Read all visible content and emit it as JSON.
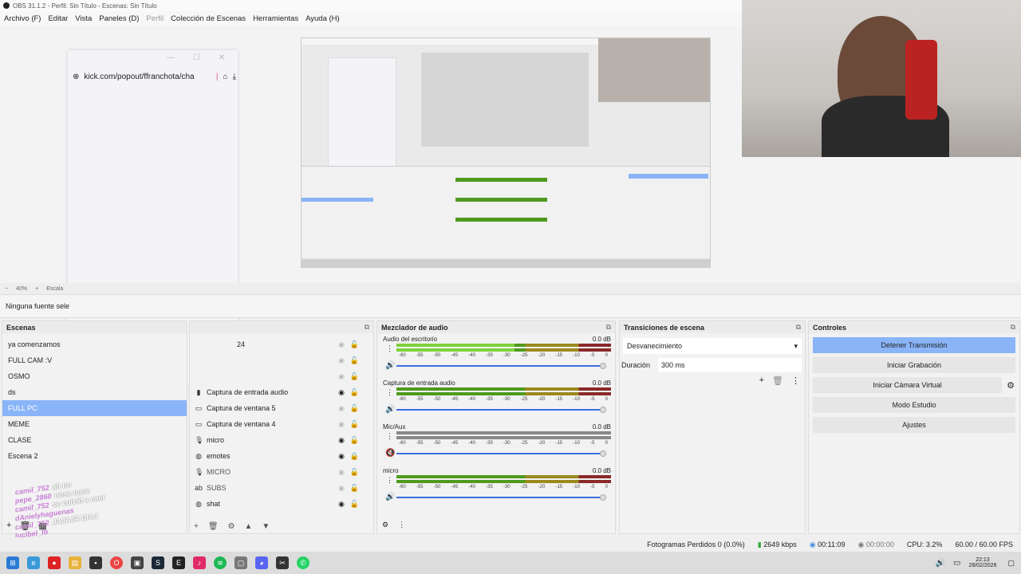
{
  "window": {
    "title": "OBS 31.1.2 - Perfil: Sin Título - Escenas: Sin Título"
  },
  "menu": {
    "items": [
      "Archivo (F)",
      "Editar",
      "Vista",
      "Paneles (D)",
      "Perfil",
      "Colección de Escenas",
      "Herramientas",
      "Ayuda (H)"
    ]
  },
  "popup": {
    "url": "kick.com/popout/ffranchota/cha"
  },
  "zoom": {
    "level": "40%",
    "label": "Escala"
  },
  "source_bar": {
    "text": "Ninguna fuente sele"
  },
  "scenes": {
    "title": "Escenas",
    "items": [
      "ya comenzamos",
      "FULL CAM :V",
      "OSMO",
      "ds",
      "FULL PC",
      "MEME",
      "CLASE",
      "Escena 2"
    ],
    "selected": "FULL PC"
  },
  "sources": {
    "partial_top": "24",
    "items": [
      "Captura de entrada audio",
      "Captura de ventana 5",
      "Captura de ventana 4",
      "micro",
      "emotes",
      "MICRO",
      "SUBS",
      "shat"
    ]
  },
  "mixer": {
    "title": "Mezclador de audio",
    "scale": [
      "-60",
      "-55",
      "-50",
      "-45",
      "-40",
      "-35",
      "-30",
      "-25",
      "-20",
      "-15",
      "-10",
      "-5",
      "0"
    ],
    "channels": [
      {
        "name": "Audio del escritorio",
        "db": "0.0 dB",
        "level": 0.55,
        "muted": false
      },
      {
        "name": "Captura de entrada audio",
        "db": "0.0 dB",
        "level": 0.0,
        "muted": false
      },
      {
        "name": "Mic/Aux",
        "db": "0.0 dB",
        "level": 0.0,
        "muted": true
      },
      {
        "name": "micro",
        "db": "0.0 dB",
        "level": 0.0,
        "muted": false
      }
    ]
  },
  "transitions": {
    "title": "Transiciones de escena",
    "selected": "Desvanecimiento",
    "duration_label": "Duración",
    "duration_value": "300 ms"
  },
  "controls": {
    "title": "Controles",
    "buttons": [
      "Detener Transmisión",
      "Iniciar Grabación",
      "Iniciar Cámara Virtual",
      "Modo Estudio",
      "Ajustes"
    ]
  },
  "chat": [
    {
      "user": "camil_752",
      "msg": "ah no"
    },
    {
      "user": "pepe_2860",
      "msg": "nose nose"
    },
    {
      "user": "camil_752",
      "msg": "se volvió a caer"
    },
    {
      "user": "dAnielyhaguenas",
      "msg": ""
    },
    {
      "user": "camil_752",
      "msg": "JAJAJA DIAJ"
    },
    {
      "user": "lucibel_lb",
      "msg": ""
    }
  ],
  "status": {
    "frames_lost": "Fotogramas Perdidos 0 (0.0%)",
    "bitrate": "2649 kbps",
    "stream_time": "00:11:09",
    "rec_time": "00:00:00",
    "cpu": "CPU: 3.2%",
    "fps": "60.00 / 60.00 FPS"
  },
  "clock": {
    "time": "22:13",
    "date": "28/02/2026"
  },
  "colors": {
    "selected": "#8ab4f8",
    "meter_green": "#4e9a1e",
    "slider": "#3b6fe0"
  }
}
